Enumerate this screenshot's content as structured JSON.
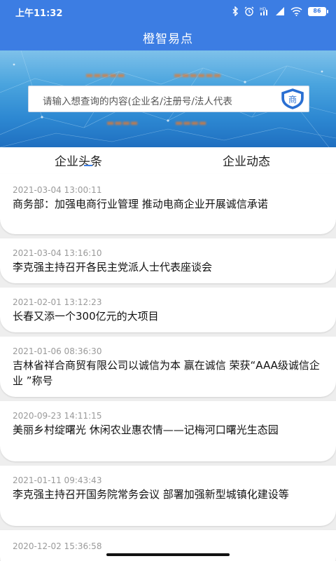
{
  "status_bar": {
    "time": "上午11:32",
    "icons": [
      "bluetooth-icon",
      "alarm-icon",
      "hd-signal-icon",
      "signal-icon",
      "wifi-icon"
    ],
    "battery": "86"
  },
  "app_bar": {
    "title": "橙智易点"
  },
  "banner": {
    "search_placeholder": "请输入想查询的内容(企业名/注册号/法人代表",
    "badge_char": "商"
  },
  "tabs": [
    {
      "label": "企业头条"
    },
    {
      "label": "企业动态"
    }
  ],
  "news": [
    {
      "time": "2021-03-04 13:00:11",
      "title": "商务部：加强电商行业管理 推动电商企业开展诚信承诺"
    },
    {
      "time": "2021-03-04 13:16:10",
      "title": "李克强主持召开各民主党派人士代表座谈会"
    },
    {
      "time": "2021-02-01 13:12:23",
      "title": "长春又添一个300亿元的大项目"
    },
    {
      "time": "2021-01-06 08:36:30",
      "title": "吉林省祥合商贸有限公司以诚信为本 赢在诚信 荣获“AAA级诚信企业 ”称号"
    },
    {
      "time": "2020-09-23 14:11:15",
      "title": "美丽乡村绽曙光 休闲农业惠农情——记梅河口曙光生态园"
    },
    {
      "time": "2021-01-11 09:43:43",
      "title": "李克强主持召开国务院常务会议 部署加强新型城镇化建设等"
    },
    {
      "time": "2020-12-02 15:36:58",
      "title": ""
    }
  ],
  "colors": {
    "primary": "#3c7de3",
    "accent": "#e9792b",
    "background": "#eeeeee"
  }
}
